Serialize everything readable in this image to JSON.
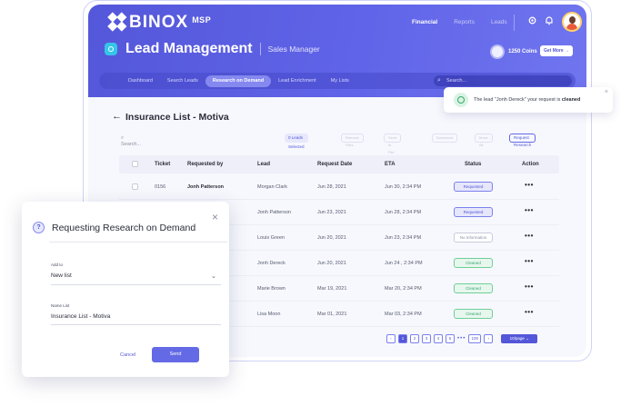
{
  "brand": {
    "name": "BINOX",
    "suffix": "MSP"
  },
  "topnav": {
    "items": [
      "Financial",
      "Reports",
      "Leads"
    ]
  },
  "header": {
    "title": "Lead Management",
    "role": "Sales Manager",
    "coins": "1250 Coins",
    "get_more": "Get More"
  },
  "subnav": {
    "tabs": [
      "Dashboard",
      "Search Leads",
      "Research on Demand",
      "Lead Enrichment",
      "My Lists"
    ],
    "active_tab": "Research on Demand",
    "search_placeholder": "Search..."
  },
  "toast": {
    "prefix": "The lead \"Jonh Dereck\" your request is",
    "status": "cleaned"
  },
  "list": {
    "title": "Insurance List - Motiva",
    "search_placeholder": "Search...",
    "leads_selected": "0 Leads Selected",
    "toolbar_disabled": [
      "Remove Files",
      "Send to File",
      "Download",
      "Move All"
    ],
    "request_research": "Request Research"
  },
  "table": {
    "columns": [
      "Ticket",
      "Requested by",
      "Lead",
      "Request Date",
      "ETA",
      "Status",
      "Action"
    ],
    "rows": [
      {
        "ticket": "0156",
        "requested_by": "Jonh Patterson",
        "lead": "Morgan Clark",
        "date": "Jun 28, 2021",
        "eta": "Jun 30, 2:34 PM",
        "status": "Requested"
      },
      {
        "ticket": "",
        "requested_by": "",
        "lead": "Jonh Patterson",
        "date": "Jun 23, 2021",
        "eta": "Jun 28, 2:34 PM",
        "status": "Requested"
      },
      {
        "ticket": "",
        "requested_by": "",
        "lead": "Louis Green",
        "date": "Jun 20, 2021",
        "eta": "Jun 23, 2:34 PM",
        "status": "No Information"
      },
      {
        "ticket": "",
        "requested_by": "",
        "lead": "Jonh Dereck",
        "date": "Jun 20, 2021",
        "eta": "Jun 24 , 2:34 PM",
        "status": "Cleaned"
      },
      {
        "ticket": "",
        "requested_by": "",
        "lead": "Marie Brown",
        "date": "Mar 19, 2021",
        "eta": "Mar 20, 2:34 PM",
        "status": "Cleaned"
      },
      {
        "ticket": "",
        "requested_by": "",
        "lead": "Lisa Moon",
        "date": "Mar 01, 2021",
        "eta": "Mar 03, 2:34 PM",
        "status": "Cleaned"
      }
    ],
    "action_glyph": "•••"
  },
  "pagination": {
    "pages": [
      "1",
      "2",
      "3",
      "4",
      "5"
    ],
    "ellipsis": "•••",
    "last": "100",
    "per_page": "10/page"
  },
  "modal": {
    "title": "Requesting Research on Demand",
    "add_to_label": "Add to",
    "add_to_value": "New list",
    "name_label": "Name List",
    "name_value": "Insurance List - Motiva",
    "cancel": "Cancel",
    "send": "Send"
  },
  "colors": {
    "primary": "#5457d9",
    "cleaned": "#3aa76d",
    "accent_cyan": "#35c5e8"
  }
}
